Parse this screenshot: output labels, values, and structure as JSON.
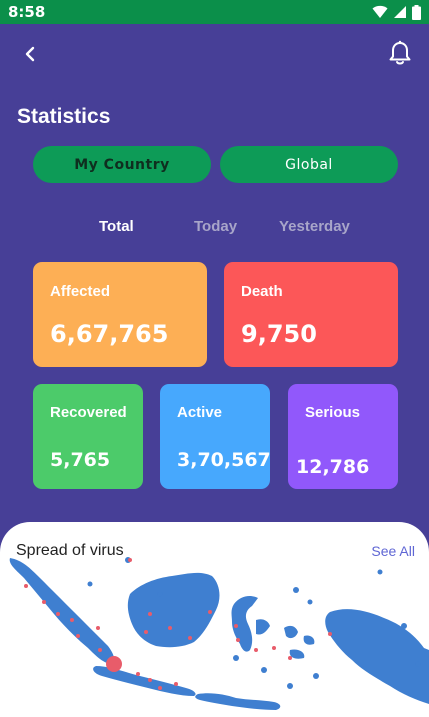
{
  "status_bar": {
    "time": "8:58"
  },
  "header": {
    "title": "Statistics"
  },
  "scope": {
    "my_country": "My Country",
    "global": "Global"
  },
  "periods": {
    "total": "Total",
    "today": "Today",
    "yesterday": "Yesterday",
    "selected": "Total"
  },
  "stats": {
    "affected": {
      "label": "Affected",
      "value": "6,67,765"
    },
    "death": {
      "label": "Death",
      "value": "9,750"
    },
    "recovered": {
      "label": "Recovered",
      "value": "5,765"
    },
    "active": {
      "label": "Active",
      "value": "3,70,567"
    },
    "serious": {
      "label": "Serious",
      "value": "12,786"
    }
  },
  "spread": {
    "title": "Spread of virus",
    "see_all": "See All"
  },
  "icons": {
    "wifi": "wifi-icon",
    "signal": "signal-icon",
    "battery": "battery-icon",
    "back": "chevron-left-icon",
    "bell": "bell-icon"
  },
  "colors": {
    "background": "#473f97",
    "status_bar": "#0b8f4a",
    "toggle": "#0d9b57",
    "affected": "#fdaf55",
    "death": "#fc5758",
    "recovered": "#4ccb6a",
    "active": "#47a8fd",
    "serious": "#9158fb",
    "map_land": "#3f7fd0",
    "map_marker": "#e85c6a"
  }
}
